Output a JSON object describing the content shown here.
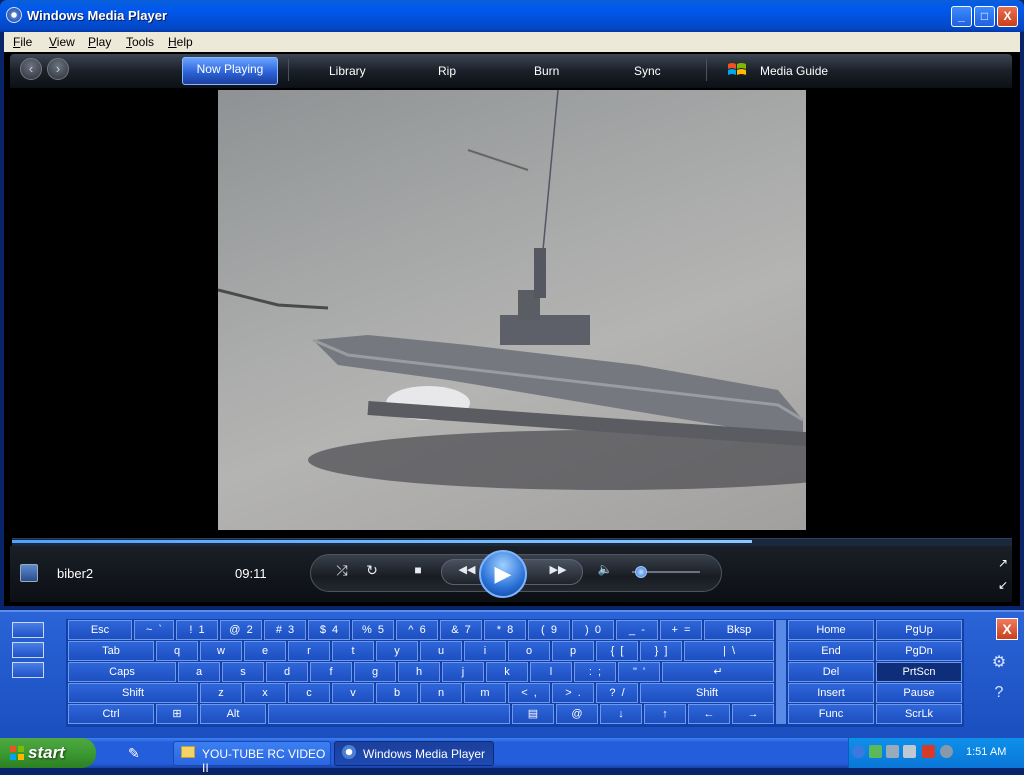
{
  "window": {
    "title": "Windows Media Player",
    "minimize": "_",
    "maximize": "□",
    "close": "X"
  },
  "menu": [
    "File",
    "View",
    "Play",
    "Tools",
    "Help"
  ],
  "nav": {
    "back": "‹",
    "forward": "›",
    "tabs": [
      "Now Playing",
      "Library",
      "Rip",
      "Burn",
      "Sync",
      "Media Guide"
    ]
  },
  "player": {
    "title": "biber2",
    "time": "09:11",
    "seek_fraction": 0.74,
    "volume_fraction": 0.12
  },
  "controls": {
    "shuffle": "⤮",
    "repeat": "↻",
    "stop": "■",
    "rewind": "◀◀",
    "play": "▶",
    "fast_forward": "▶▶",
    "mute": "🔈"
  },
  "keyboard": {
    "rows": [
      [
        "Esc",
        "~  `",
        "!  1",
        "@  2",
        "#  3",
        "$  4",
        "%  5",
        "^  6",
        "&  7",
        "*  8",
        "(  9",
        ")  0",
        "_  -",
        "+  =",
        "Bksp"
      ],
      [
        "Tab",
        "q",
        "w",
        "e",
        "r",
        "t",
        "y",
        "u",
        "i",
        "o",
        "p",
        "{  [",
        "}  ]",
        "|  \\"
      ],
      [
        "Caps",
        "a",
        "s",
        "d",
        "f",
        "g",
        "h",
        "j",
        "k",
        "l",
        ":  ;",
        "\"  '",
        "↵"
      ],
      [
        "Shift",
        "z",
        "x",
        "c",
        "v",
        "b",
        "n",
        "m",
        "<  ,",
        ">  .",
        "?  /",
        "Shift"
      ],
      [
        "Ctrl",
        "⊞",
        "Alt",
        "",
        "▤",
        "@",
        "↓",
        "↑",
        "←",
        "→"
      ]
    ],
    "nav_keys": [
      [
        "Home",
        "PgUp"
      ],
      [
        "End",
        "PgDn"
      ],
      [
        "Del",
        "PrtScn"
      ],
      [
        "Insert",
        "Pause"
      ],
      [
        "Func",
        "ScrLk"
      ]
    ],
    "close": "X",
    "settings": "⚙",
    "help": "?"
  },
  "taskbar": {
    "start": "start",
    "items": [
      "YOU-TUBE RC VIDEO II",
      "Windows Media Player"
    ],
    "clock": "1:51 AM"
  },
  "colors": {
    "accent": "#245edb",
    "start_green": "#3c9a32",
    "wmp_blue": "#2c63d8"
  }
}
